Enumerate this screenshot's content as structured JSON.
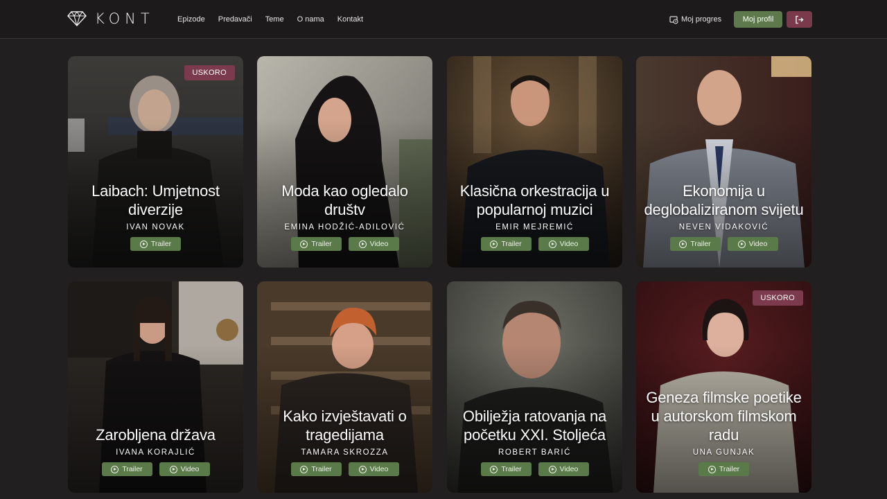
{
  "brand": {
    "name": "KONT",
    "logo_icon": "diamond-icon"
  },
  "nav": {
    "links": [
      "Epizode",
      "Predavači",
      "Teme",
      "O nama",
      "Kontakt"
    ],
    "progress_label": "Moj progres",
    "profile_label": "Moj profil",
    "logout_icon": "logout-icon"
  },
  "colors": {
    "background": "#211f20",
    "accent_green": "#5e7a4d",
    "accent_wine": "#7b3a4e"
  },
  "cards": [
    {
      "title": "Laibach: Umjetnost diverzije",
      "author": "IVAN NOVAK",
      "badge": "USKORO",
      "trailer": "Trailer",
      "video": ""
    },
    {
      "title": "Moda kao ogledalo društv",
      "author": "EMINA HODŽIĆ-ADILOVIĆ",
      "badge": "",
      "trailer": "Trailer",
      "video": "Video"
    },
    {
      "title": "Klasična orkestracija u popularnoj muzici",
      "author": "EMIR MEJREMIĆ",
      "badge": "",
      "trailer": "Trailer",
      "video": "Video"
    },
    {
      "title": "Ekonomija u deglobaliziranom svijetu",
      "author": "NEVEN VIDAKOVIĆ",
      "badge": "",
      "trailer": "Trailer",
      "video": "Video"
    },
    {
      "title": "Zarobljena država",
      "author": "IVANA KORAJLIĆ",
      "badge": "",
      "trailer": "Trailer",
      "video": "Video"
    },
    {
      "title": "Kako izvještavati o tragedijama",
      "author": "TAMARA SKROZZA",
      "badge": "",
      "trailer": "Trailer",
      "video": "Video"
    },
    {
      "title": "Obilježja ratovanja na početku XXI. Stoljeća",
      "author": "ROBERT BARIĆ",
      "badge": "",
      "trailer": "Trailer",
      "video": "Video"
    },
    {
      "title": "Geneza filmske poetike u autorskom filmskom radu",
      "author": "UNA GUNJAK",
      "badge": "USKORO",
      "trailer": "Trailer",
      "video": ""
    }
  ]
}
